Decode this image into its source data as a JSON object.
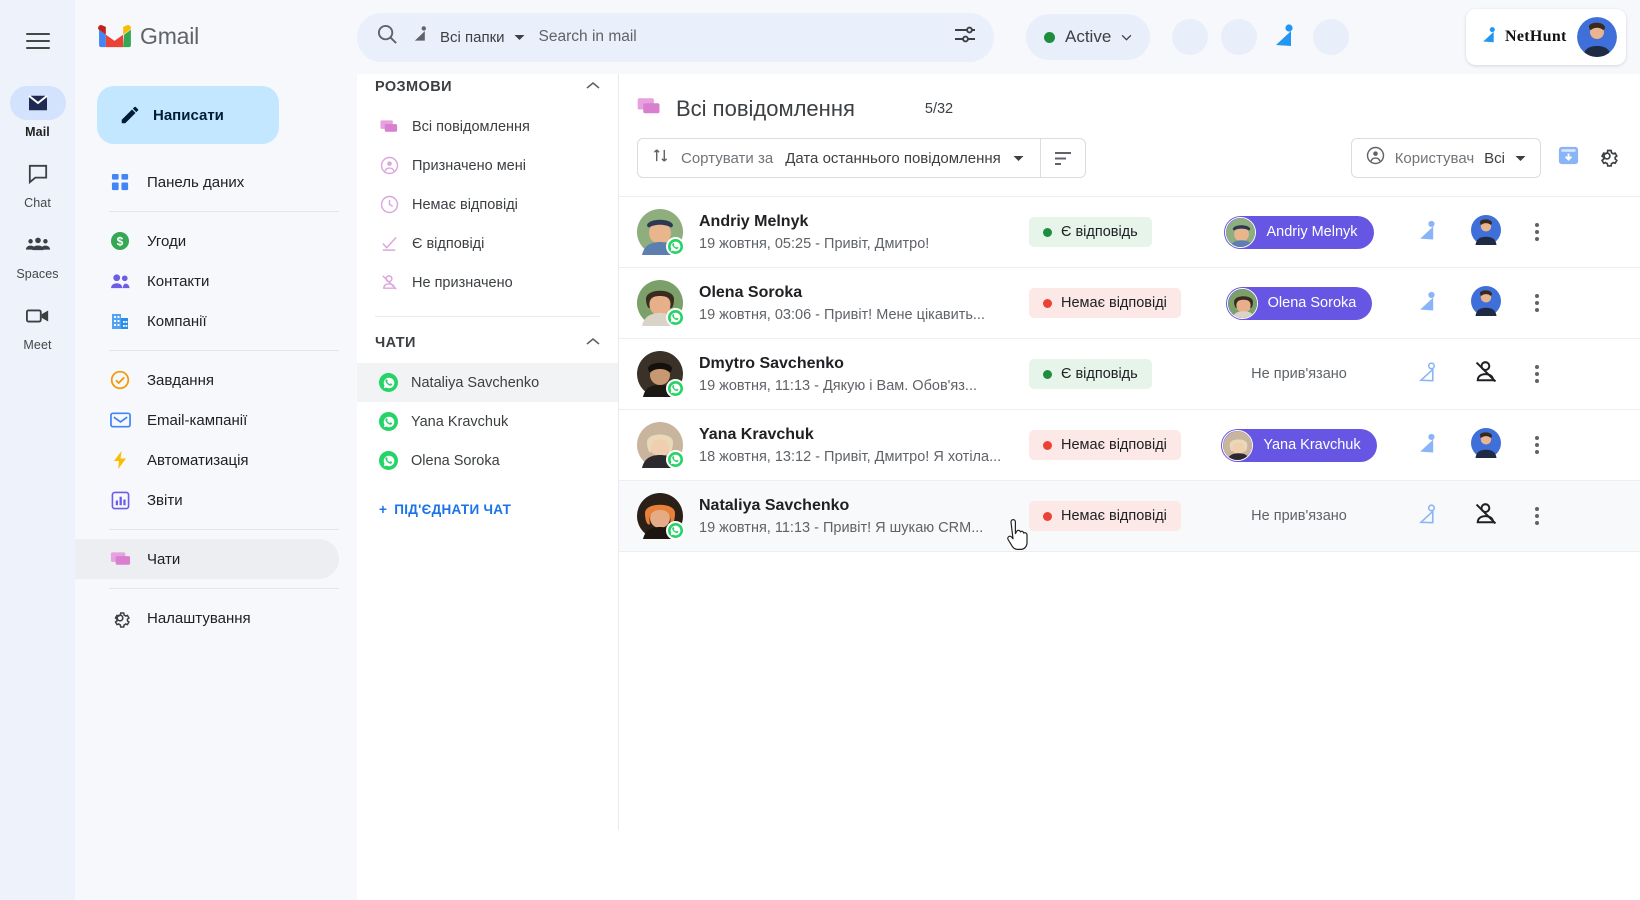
{
  "rail": {
    "menu_icon": "hamburger-icon",
    "items": [
      {
        "label": "Mail",
        "icon": "mail-icon",
        "active": true
      },
      {
        "label": "Chat",
        "icon": "chat-icon",
        "active": false
      },
      {
        "label": "Spaces",
        "icon": "spaces-icon",
        "active": false
      },
      {
        "label": "Meet",
        "icon": "meet-icon",
        "active": false
      }
    ]
  },
  "gmail_nav": {
    "brand": "Gmail",
    "compose_label": "Написати",
    "items": [
      {
        "label": "Панель даних",
        "icon": "dashboard-icon"
      },
      {
        "label": "Угоди",
        "icon": "deals-dollar-icon"
      },
      {
        "label": "Контакти",
        "icon": "contacts-people-icon"
      },
      {
        "label": "Компанії",
        "icon": "companies-building-icon"
      },
      {
        "label": "Завдання",
        "icon": "tasks-check-icon"
      },
      {
        "label": "Email-кампанії",
        "icon": "email-campaign-icon"
      },
      {
        "label": "Автоматизація",
        "icon": "automation-bolt-icon"
      },
      {
        "label": "Звіти",
        "icon": "reports-chart-icon"
      },
      {
        "label": "Чати",
        "icon": "chats-bubble-icon",
        "active": true
      },
      {
        "label": "Налаштування",
        "icon": "settings-gear-icon"
      }
    ]
  },
  "crm_panel": {
    "title": "Панель даних",
    "sections": [
      {
        "title": "РОЗМОВИ",
        "collapse_icon": "chevron-up-icon",
        "items": [
          {
            "label": "Всі повідомлення",
            "icon": "all-messages-icon",
            "active": false
          },
          {
            "label": "Призначено мені",
            "icon": "assigned-to-me-icon",
            "active": false
          },
          {
            "label": "Немає відповіді",
            "icon": "no-reply-clock-icon",
            "active": false
          },
          {
            "label": "Є відповіді",
            "icon": "has-reply-check-icon",
            "active": false
          },
          {
            "label": "Не призначено",
            "icon": "unassigned-person-icon",
            "active": false
          }
        ]
      },
      {
        "title": "ЧАТИ",
        "collapse_icon": "chevron-up-icon",
        "items": [
          {
            "label": "Nataliya Savchenko",
            "icon": "whatsapp-icon",
            "active": true
          },
          {
            "label": "Yana Kravchuk",
            "icon": "whatsapp-icon",
            "active": false
          },
          {
            "label": "Olena Soroka",
            "icon": "whatsapp-icon",
            "active": false
          }
        ]
      }
    ],
    "connect_label": "ПІД'ЄДНАТИ ЧАТ",
    "connect_icon": "plus-icon"
  },
  "header": {
    "search": {
      "search_icon": "search-icon",
      "folder_icon": "nethunt-folder-icon",
      "folder_label": "Всі папки",
      "folder_chevron": "chevron-down-icon",
      "placeholder": "Search in mail",
      "options_icon": "search-options-icon"
    },
    "status": {
      "label": "Active",
      "color": "#1e8e3e",
      "chevron": "chevron-down-icon"
    },
    "brand": {
      "name": "NetHunt",
      "logo_icon": "nethunt-logo-icon",
      "avatar": "user-avatar"
    }
  },
  "main": {
    "title": "Всі повідомлення",
    "title_icon": "all-messages-icon",
    "count": "5/32",
    "toolbar": {
      "sort_icon": "sort-arrows-icon",
      "sort_label": "Сортувати за",
      "sort_value": "Дата останнього повідомлення",
      "sort_chevron": "chevron-down-icon",
      "sort_direction_icon": "sort-descending-icon",
      "user_icon": "user-circle-icon",
      "user_label": "Користувач",
      "user_value": "Всі",
      "user_chevron": "chevron-down-icon",
      "archive_icon": "archive-download-icon",
      "settings_icon": "gear-icon"
    },
    "rows": [
      {
        "name": "Andriy Melnyk",
        "preview": "19 жовтня, 05:25 - Привіт, Дмитро!",
        "channel_icon": "whatsapp-icon",
        "status": {
          "label": "Є відповідь",
          "kind": "ok"
        },
        "contact": {
          "linked": true,
          "name": "Andriy Melnyk"
        },
        "link_icon": "nethunt-linked-icon",
        "assignee_icon": "assignee-avatar",
        "menu_icon": "more-vertical-icon",
        "avatar_colors": [
          "#7f6a52",
          "#c9a887"
        ],
        "hover": false
      },
      {
        "name": "Olena Soroka",
        "preview": "19 жовтня, 03:06 - Привіт! Мене цікавить...",
        "channel_icon": "whatsapp-icon",
        "status": {
          "label": "Немає відповіді",
          "kind": "no"
        },
        "contact": {
          "linked": true,
          "name": "Olena Soroka"
        },
        "link_icon": "nethunt-linked-icon",
        "assignee_icon": "assignee-avatar",
        "menu_icon": "more-vertical-icon",
        "avatar_colors": [
          "#6d8f5e",
          "#3c2f26"
        ],
        "hover": false
      },
      {
        "name": "Dmytro Savchenko",
        "preview": "19 жовтня, 11:13 - Дякую і Вам. Обов'яз...",
        "channel_icon": "whatsapp-icon",
        "status": {
          "label": "Є відповідь",
          "kind": "ok"
        },
        "contact": {
          "linked": false,
          "name": "Не прив'язано"
        },
        "link_icon": "nethunt-unlinked-icon",
        "assignee_icon": "unassigned-person-icon",
        "menu_icon": "more-vertical-icon",
        "avatar_colors": [
          "#4a4036",
          "#1c1814"
        ],
        "hover": false
      },
      {
        "name": "Yana Kravchuk",
        "preview": "18 жовтня, 13:12 - Привіт, Дмитро! Я хотіла...",
        "channel_icon": "whatsapp-icon",
        "status": {
          "label": "Немає відповіді",
          "kind": "no"
        },
        "contact": {
          "linked": true,
          "name": "Yana Kravchuk"
        },
        "link_icon": "nethunt-linked-icon",
        "assignee_icon": "assignee-avatar",
        "menu_icon": "more-vertical-icon",
        "avatar_colors": [
          "#d9c2a6",
          "#8a6a4e"
        ],
        "hover": false
      },
      {
        "name": "Nataliya Savchenko",
        "preview": "19 жовтня, 11:13 - Привіт! Я шукаю CRM...",
        "channel_icon": "whatsapp-icon",
        "status": {
          "label": "Немає відповіді",
          "kind": "no"
        },
        "contact": {
          "linked": false,
          "name": "Не прив'язано"
        },
        "link_icon": "nethunt-unlinked-icon",
        "assignee_icon": "unassigned-person-icon",
        "menu_icon": "more-vertical-icon",
        "avatar_colors": [
          "#e8803a",
          "#2b2018"
        ],
        "hover": true
      }
    ]
  },
  "colors": {
    "accent_blue": "#1a73e8",
    "nethunt_blue": "#2196f3",
    "chip_purple": "#6656e3",
    "whatsapp_green": "#25d366",
    "status_ok": "#1e8e3e",
    "status_no": "#ea4335"
  }
}
